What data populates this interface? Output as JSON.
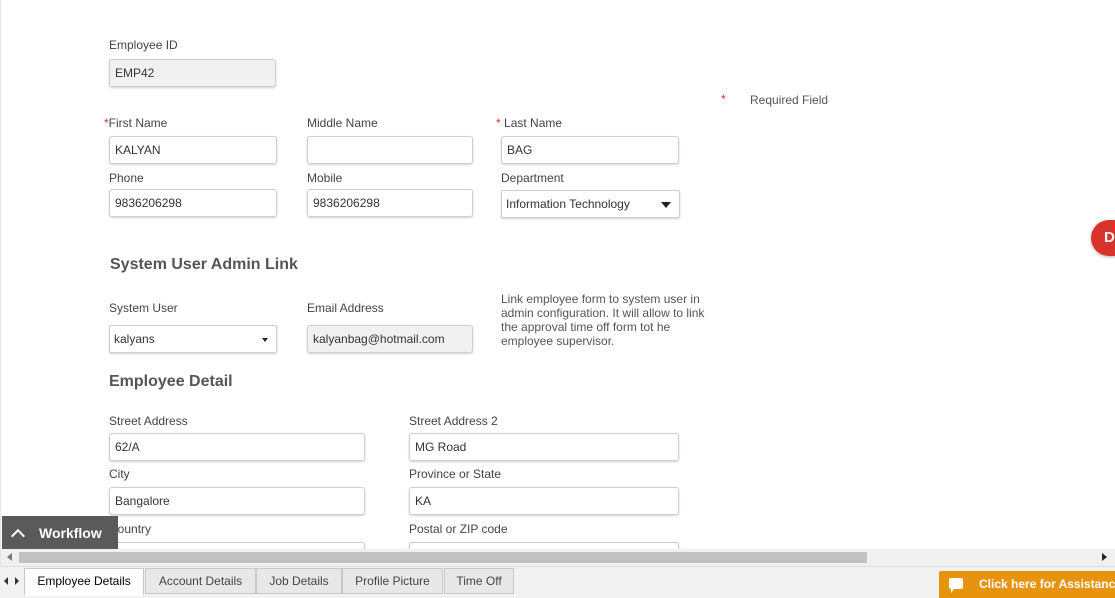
{
  "form": {
    "employee_id": {
      "label": "Employee ID",
      "value": "EMP42"
    },
    "required_marker": "*",
    "required_note": "Required Field",
    "first_name": {
      "label": "First Name",
      "value": "KALYAN"
    },
    "middle_name": {
      "label": "Middle Name",
      "value": ""
    },
    "last_name": {
      "label": "Last Name",
      "value": "BAG"
    },
    "phone": {
      "label": "Phone",
      "value": "9836206298"
    },
    "mobile": {
      "label": "Mobile",
      "value": "9836206298"
    },
    "department": {
      "label": "Department",
      "value": "Information Technology"
    }
  },
  "admin_link": {
    "heading": "System User Admin Link",
    "system_user": {
      "label": "System User",
      "value": "kalyans"
    },
    "email": {
      "label": "Email Address",
      "value": "kalyanbag@hotmail.com"
    },
    "note": "Link employee form to system user in admin configuration. It will allow to link the approval time off form tot he employee supervisor."
  },
  "employee_detail": {
    "heading": "Employee Detail",
    "street1": {
      "label": "Street Address",
      "value": "62/A"
    },
    "street2": {
      "label": "Street Address 2",
      "value": "MG Road"
    },
    "city": {
      "label": "City",
      "value": "Bangalore"
    },
    "state": {
      "label": "Province or State",
      "value": "KA"
    },
    "country": {
      "label": "Country",
      "value": ""
    },
    "postal": {
      "label": "Postal or ZIP code",
      "value": ""
    }
  },
  "workflow": {
    "label": "Workflow",
    "icon": "chevron-up-icon"
  },
  "side_button": {
    "label": "D"
  },
  "tabs": [
    {
      "label": "Employee Details",
      "active": true
    },
    {
      "label": "Account Details",
      "active": false
    },
    {
      "label": "Job Details",
      "active": false
    },
    {
      "label": "Profile Picture",
      "active": false
    },
    {
      "label": "Time Off",
      "active": false
    }
  ],
  "assist": {
    "label": "Click here for Assistance",
    "icon": "chat-icon"
  },
  "colors": {
    "accent": "#e8930e",
    "required": "#d9332b",
    "workflow_bg": "#5a5a5a"
  }
}
